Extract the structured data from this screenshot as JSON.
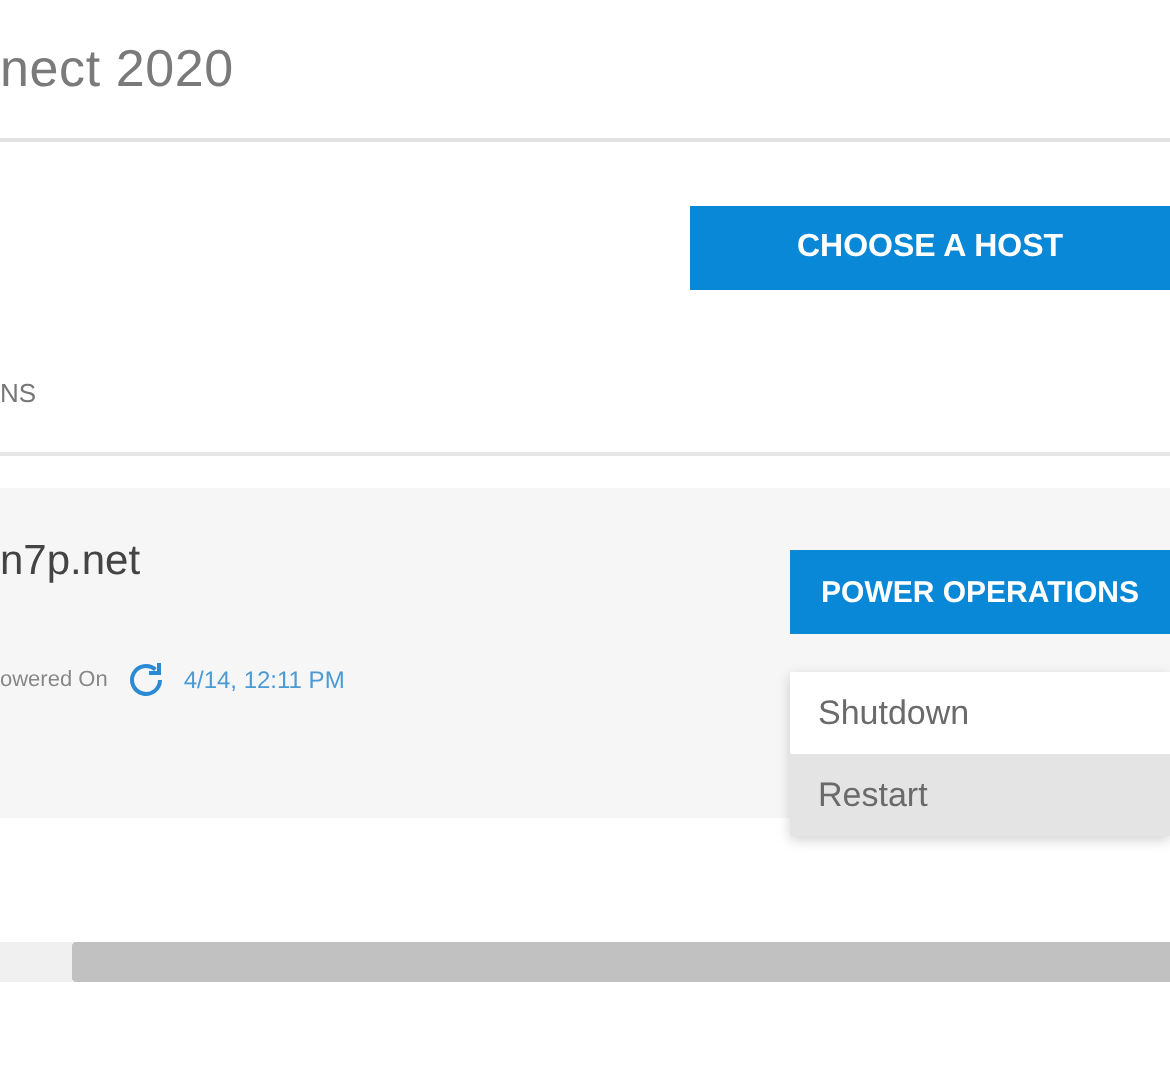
{
  "header": {
    "title": "nect 2020"
  },
  "choose_button": {
    "label": "CHOOSE A HOST"
  },
  "section_heading": "NS",
  "host": {
    "name": "n7p.net",
    "status": "owered On",
    "timestamp": "4/14, 12:11 PM"
  },
  "power_button": {
    "label": "POWER OPERATIONS"
  },
  "power_menu": [
    {
      "label": "Shutdown",
      "selected": false
    },
    {
      "label": "Restart",
      "selected": true
    }
  ]
}
